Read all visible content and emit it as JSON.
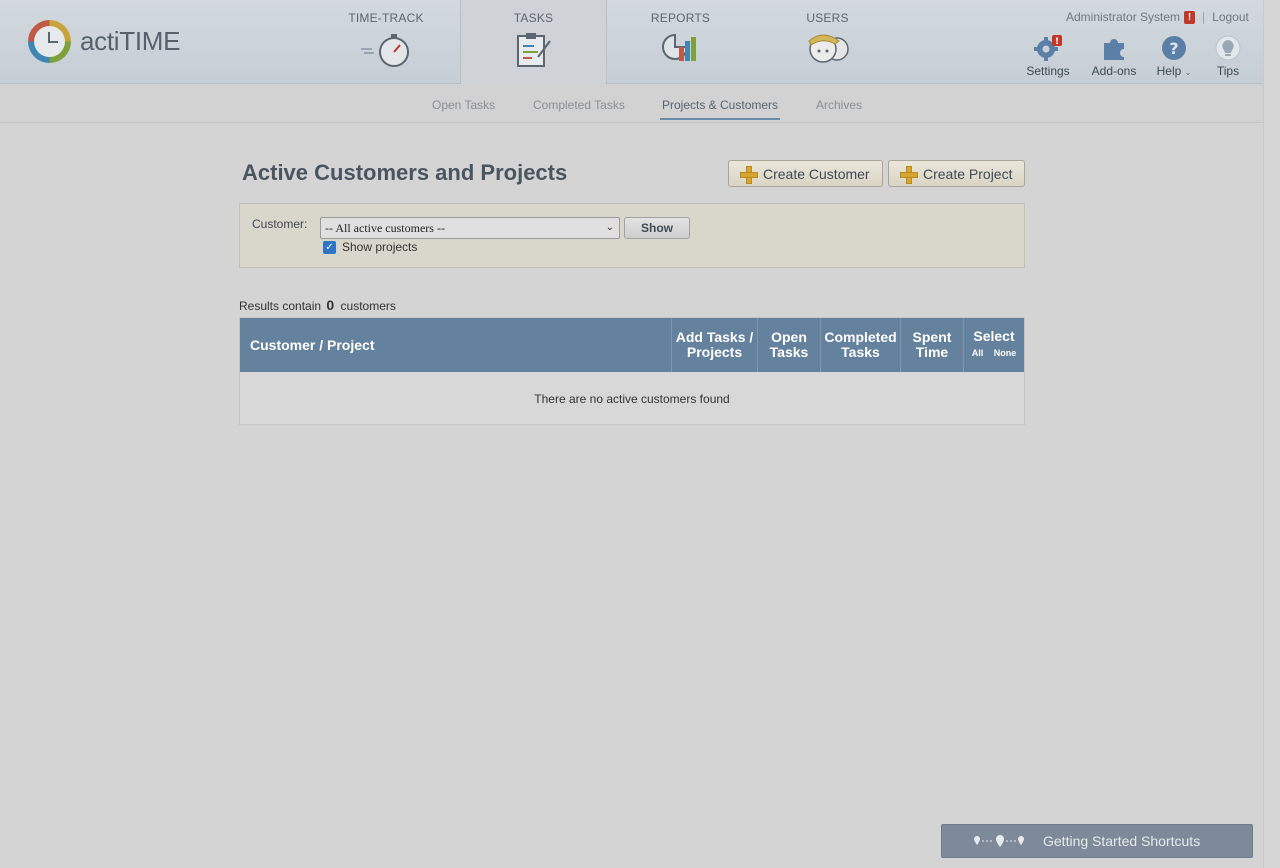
{
  "app": {
    "name": "actiTIME"
  },
  "nav": {
    "tabs": [
      {
        "label": "TIME-TRACK"
      },
      {
        "label": "TASKS",
        "active": true
      },
      {
        "label": "REPORTS"
      },
      {
        "label": "USERS"
      }
    ]
  },
  "user": {
    "name": "Administrator System",
    "logout": "Logout"
  },
  "tools": {
    "settings": "Settings",
    "addons": "Add-ons",
    "help": "Help",
    "tips": "Tips",
    "settings_badge": "!"
  },
  "subnav": {
    "items": [
      {
        "label": "Open Tasks"
      },
      {
        "label": "Completed Tasks"
      },
      {
        "label": "Projects & Customers",
        "active": true
      },
      {
        "label": "Archives"
      }
    ]
  },
  "main": {
    "title": "Active Customers and Projects",
    "create_customer": "Create Customer",
    "create_project": "Create Project"
  },
  "filter": {
    "customer_label": "Customer:",
    "customer_selected": "-- All active customers --",
    "show_button": "Show",
    "show_projects_label": "Show projects",
    "show_projects_checked": true
  },
  "results": {
    "prefix": "Results contain",
    "count": "0",
    "suffix": "customers"
  },
  "table": {
    "col_customer": "Customer / Project",
    "col_add_line1": "Add Tasks /",
    "col_add_line2": "Projects",
    "col_open_line1": "Open",
    "col_open_line2": "Tasks",
    "col_completed_line1": "Completed",
    "col_completed_line2": "Tasks",
    "col_spent_line1": "Spent",
    "col_spent_line2": "Time",
    "col_select": "Select",
    "select_all": "All",
    "select_none": "None",
    "empty_message": "There are no active customers found"
  },
  "shortcuts": {
    "label": "Getting Started Shortcuts"
  },
  "colors": {
    "header_blue": "#64819d",
    "accent_yellow": "#d6a531",
    "badge_red": "#c0392b"
  }
}
